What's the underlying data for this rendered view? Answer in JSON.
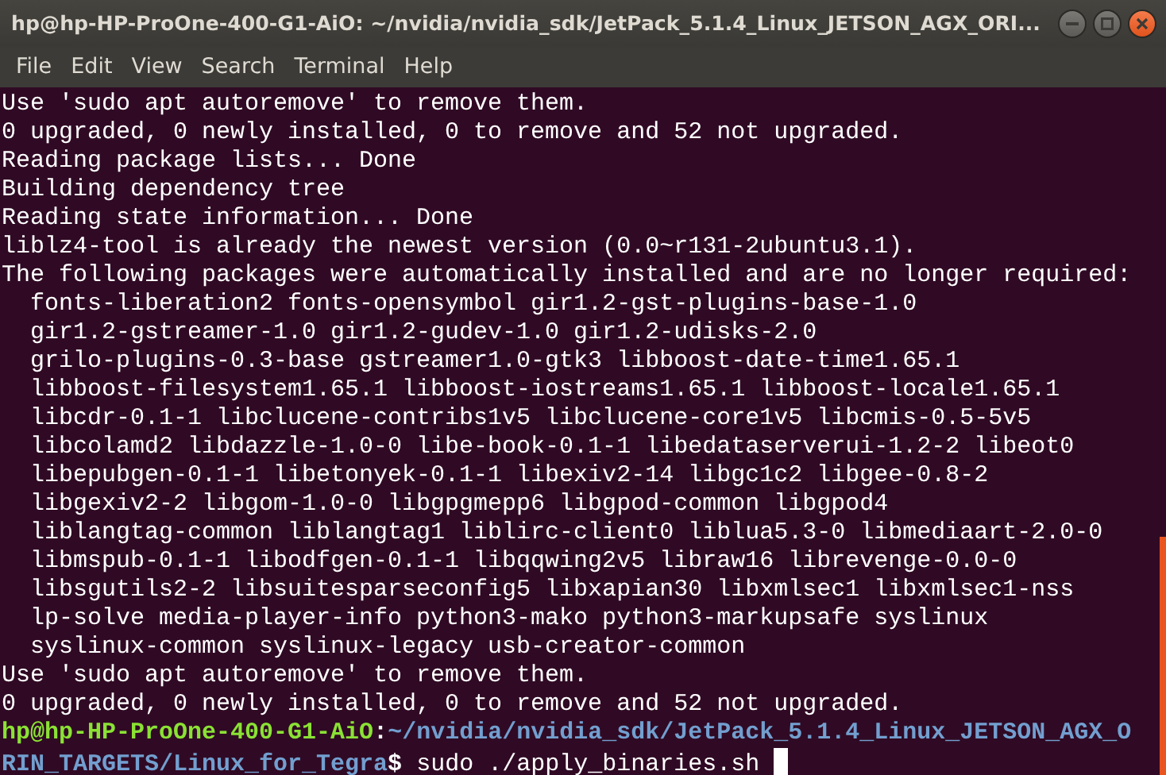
{
  "window": {
    "title": "hp@hp-HP-ProOne-400-G1-AiO: ~/nvidia/nvidia_sdk/JetPack_5.1.4_Linux_JETSON_AGX_ORI..."
  },
  "menu": [
    "File",
    "Edit",
    "View",
    "Search",
    "Terminal",
    "Help"
  ],
  "terminal": {
    "lines": [
      "Use 'sudo apt autoremove' to remove them.",
      "0 upgraded, 0 newly installed, 0 to remove and 52 not upgraded.",
      "Reading package lists... Done",
      "Building dependency tree",
      "Reading state information... Done",
      "liblz4-tool is already the newest version (0.0~r131-2ubuntu3.1).",
      "The following packages were automatically installed and are no longer required:",
      "  fonts-liberation2 fonts-opensymbol gir1.2-gst-plugins-base-1.0",
      "  gir1.2-gstreamer-1.0 gir1.2-gudev-1.0 gir1.2-udisks-2.0",
      "  grilo-plugins-0.3-base gstreamer1.0-gtk3 libboost-date-time1.65.1",
      "  libboost-filesystem1.65.1 libboost-iostreams1.65.1 libboost-locale1.65.1",
      "  libcdr-0.1-1 libclucene-contribs1v5 libclucene-core1v5 libcmis-0.5-5v5",
      "  libcolamd2 libdazzle-1.0-0 libe-book-0.1-1 libedataserverui-1.2-2 libeot0",
      "  libepubgen-0.1-1 libetonyek-0.1-1 libexiv2-14 libgc1c2 libgee-0.8-2",
      "  libgexiv2-2 libgom-1.0-0 libgpgmepp6 libgpod-common libgpod4",
      "  liblangtag-common liblangtag1 liblirc-client0 liblua5.3-0 libmediaart-2.0-0",
      "  libmspub-0.1-1 libodfgen-0.1-1 libqqwing2v5 libraw16 librevenge-0.0-0",
      "  libsgutils2-2 libsuitesparseconfig5 libxapian30 libxmlsec1 libxmlsec1-nss",
      "  lp-solve media-player-info python3-mako python3-markupsafe syslinux",
      "  syslinux-common syslinux-legacy usb-creator-common",
      "Use 'sudo apt autoremove' to remove them.",
      "0 upgraded, 0 newly installed, 0 to remove and 52 not upgraded."
    ],
    "prompt": {
      "user_host": "hp@hp-HP-ProOne-400-G1-AiO",
      "separator": ":",
      "path": "~/nvidia/nvidia_sdk/JetPack_5.1.4_Linux_JETSON_AGX_ORIN_TARGETS/Linux_for_Tegra",
      "symbol": "$",
      "command": "sudo ./apply_binaries.sh"
    }
  }
}
